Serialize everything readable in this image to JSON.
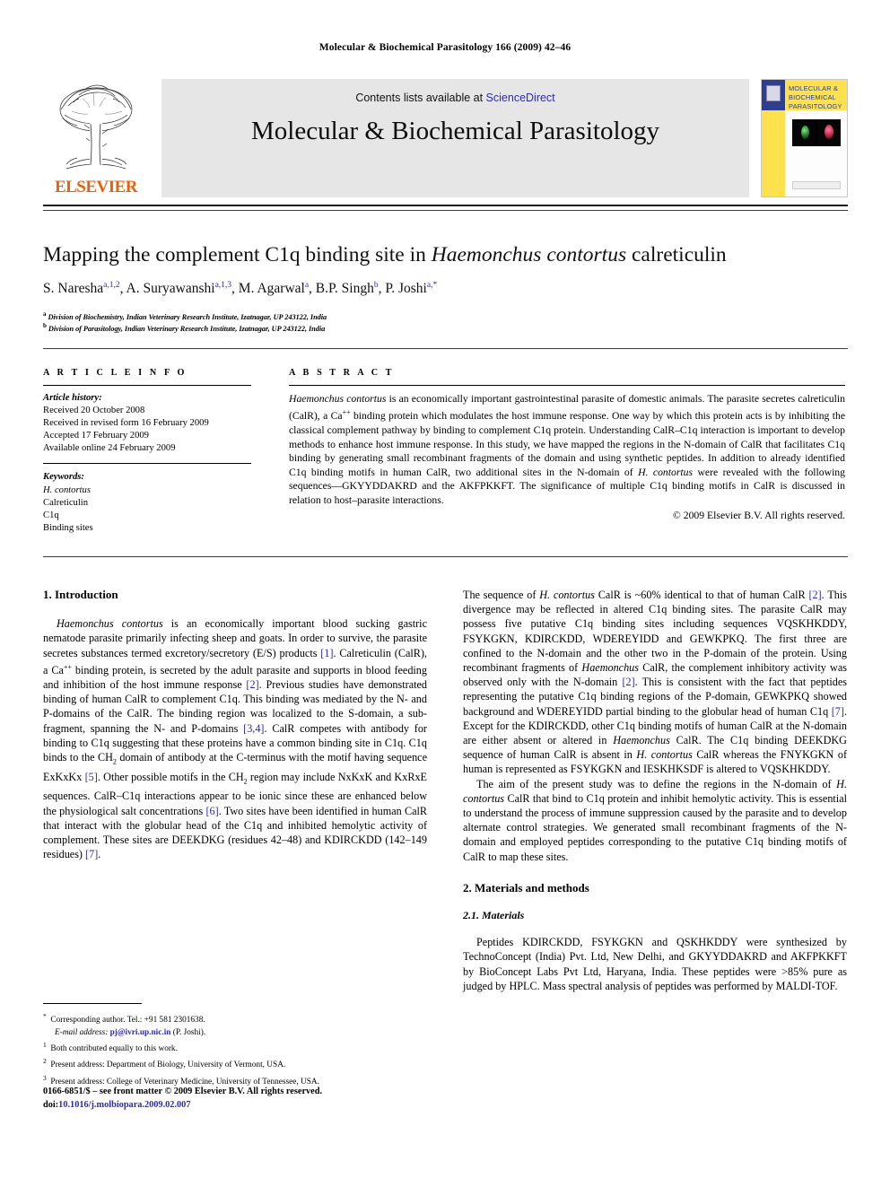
{
  "running_head": "Molecular & Biochemical Parasitology 166 (2009) 42–46",
  "masthead": {
    "publisher_name": "ELSEVIER",
    "contents_prefix": "Contents lists available at ",
    "sciencedirect": "ScienceDirect",
    "journal_title": "Molecular & Biochemical Parasitology",
    "cover_title": "MOLECULAR & BIOCHEMICAL PARASITOLOGY"
  },
  "article": {
    "title_part1": "Mapping the complement C1q binding site in ",
    "title_italic": "Haemonchus contortus",
    "title_part2": " calreticulin",
    "affiliation_a": "Division of Biochemistry, Indian Veterinary Research Institute, Izatnagar, UP 243122, India",
    "affiliation_b": "Division of Parasitology, Indian Veterinary Research Institute, Izatnagar, UP 243122, India"
  },
  "authors": [
    {
      "name": "S. Naresha",
      "marks": "a,1,2",
      "sep": ", "
    },
    {
      "name": "A. Suryawanshi",
      "marks": "a,1,3",
      "sep": ", "
    },
    {
      "name": "M. Agarwal",
      "marks": "a",
      "sep": ", "
    },
    {
      "name": "B.P. Singh",
      "marks": "b",
      "sep": ", "
    },
    {
      "name": "P. Joshi",
      "marks": "a,*",
      "sep": ""
    }
  ],
  "info": {
    "heading": "A R T I C L E    I N F O",
    "history_label": "Article history:",
    "history": [
      "Received 20 October 2008",
      "Received in revised form 16 February 2009",
      "Accepted 17 February 2009",
      "Available online 24 February 2009"
    ],
    "keywords_label": "Keywords:",
    "keywords": [
      "H. contortus",
      "Calreticulin",
      "C1q",
      "Binding sites"
    ]
  },
  "abstract": {
    "heading": "A B S T R A C T",
    "body_lead_italic": "Haemonchus contortus",
    "body": " is an economically important gastrointestinal parasite of domestic animals. The parasite secretes calreticulin (CalR), a Ca++ binding protein which modulates the host immune response. One way by which this protein acts is by inhibiting the classical complement pathway by binding to complement C1q protein. Understanding CalR–C1q interaction is important to develop methods to enhance host immune response. In this study, we have mapped the regions in the N-domain of CalR that facilitates C1q binding by generating small recombinant fragments of the domain and using synthetic peptides. In addition to already identified C1q binding motifs in human CalR, two additional sites in the N-domain of H. contortus were revealed with the following sequences—GKYYDDAKRD and the AKFPKKFT. The significance of multiple C1q binding motifs in CalR is discussed in relation to host–parasite interactions.",
    "copyright": "© 2009 Elsevier B.V. All rights reserved."
  },
  "sections": {
    "intro_heading": "1. Introduction",
    "intro_p1": "Haemonchus contortus is an economically important blood sucking gastric nematode parasite primarily infecting sheep and goats. In order to survive, the parasite secretes substances termed excretory/secretory (E/S) products [1]. Calreticulin (CalR), a Ca++ binding protein, is secreted by the adult parasite and supports in blood feeding and inhibition of the host immune response [2]. Previous studies have demonstrated binding of human CalR to complement C1q. This binding was mediated by the N- and P-domains of the CalR. The binding region was localized to the S-domain, a sub-fragment, spanning the N- and P-domains [3,4]. CalR competes with antibody for binding to C1q suggesting that these proteins have a common binding site in C1q. C1q binds to the CH2 domain of antibody at the C-terminus with the motif having sequence ExKxKx [5]. Other possible motifs in the CH2 region may include NxKxK and KxRxE sequences. CalR–C1q interactions appear to be ionic since these are enhanced below the physiological salt concentrations [6]. Two sites have been identified in human CalR that interact with the globular head of the C1q and inhibited hemolytic activity of complement. These sites are DEEKDKG (residues 42–48) and KDIRCKDD (142–149 residues) [7].",
    "intro_p2": "The sequence of H. contortus CalR is ~60% identical to that of human CalR [2]. This divergence may be reflected in altered C1q binding sites. The parasite CalR may possess five putative C1q binding sites including sequences VQSKHKDDY, FSYKGKN, KDIRCKDD, WDEREYIDD and GEWKPKQ. The first three are confined to the N-domain and the other two in the P-domain of the protein. Using recombinant fragments of Haemonchus CalR, the complement inhibitory activity was observed only with the N-domain [2]. This is consistent with the fact that peptides representing the putative C1q binding regions of the P-domain, GEWKPKQ showed background and WDEREYIDD partial binding to the globular head of human C1q [7]. Except for the KDIRCKDD, other C1q binding motifs of human CalR at the N-domain are either absent or altered in Haemonchus CalR. The C1q binding DEEKDKG sequence of human CalR is absent in H. contortus CalR whereas the FNYKGKN of human is represented as FSYKGKN and IESKHKSDF is altered to VQSKHKDDY.",
    "intro_p3": "The aim of the present study was to define the regions in the N-domain of H. contortus CalR that bind to C1q protein and inhibit hemolytic activity. This is essential to understand the process of immune suppression caused by the parasite and to develop alternate control strategies. We generated small recombinant fragments of the N-domain and employed peptides corresponding to the putative C1q binding motifs of CalR to map these sites.",
    "methods_heading": "2. Materials and methods",
    "materials_heading": "2.1. Materials",
    "materials_p1": "Peptides KDIRCKDD, FSYKGKN and QSKHKDDY were synthesized by TechnoConcept (India) Pvt. Ltd, New Delhi, and GKYYDDAKRD and AKFPKKFT by BioConcept Labs Pvt Ltd, Haryana, India. These peptides were >85% pure as judged by HPLC. Mass spectral analysis of peptides was performed by MALDI-TOF."
  },
  "footnotes": {
    "corresponding": "Corresponding author. Tel.: +91 581 2301638.",
    "email_label": "E-mail address:",
    "email": "pj@ivri.up.nic.in",
    "email_suffix": " (P. Joshi).",
    "note1": "Both contributed equally to this work.",
    "note2": "Present address: Department of Biology, University of Vermont, USA.",
    "note3": "Present address: College of Veterinary Medicine, University of Tennessee, USA."
  },
  "imprint": {
    "line1": "0166-6851/$ – see front matter © 2009 Elsevier B.V. All rights reserved.",
    "doi_label": "doi:",
    "doi": "10.1016/j.molbiopara.2009.02.007"
  },
  "colors": {
    "link": "#2b2bb5",
    "elsevier_orange": "#E8620C",
    "band_gray": "#e6e6e6",
    "cover_yellow": "#ffe14d"
  }
}
